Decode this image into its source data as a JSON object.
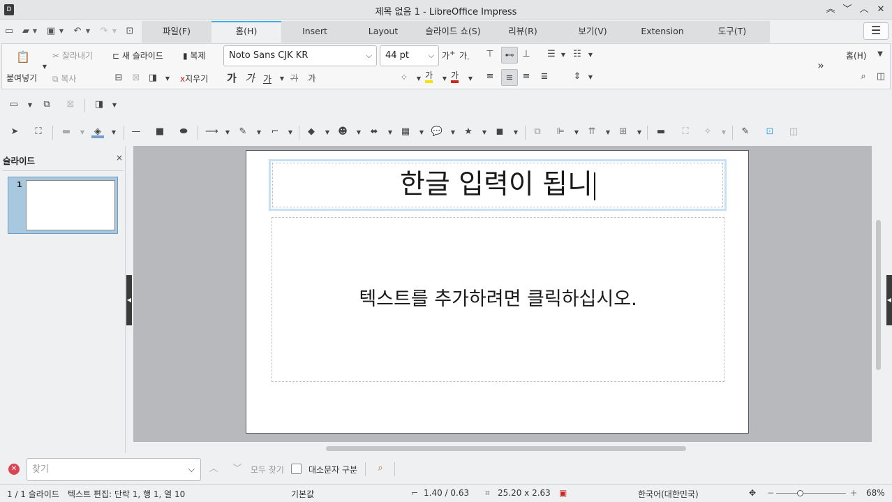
{
  "window": {
    "title": "제목 없음 1 - LibreOffice Impress"
  },
  "tabs": [
    {
      "label": "파일(F)"
    },
    {
      "label": "홈(H)"
    },
    {
      "label": "Insert"
    },
    {
      "label": "Layout"
    },
    {
      "label": "슬라이드 쇼(S)"
    },
    {
      "label": "리뷰(R)"
    },
    {
      "label": "보기(V)"
    },
    {
      "label": "Extension"
    },
    {
      "label": "도구(T)"
    }
  ],
  "ribbon": {
    "paste": "붙여넣기",
    "cut": "잘라내기",
    "copy": "복사",
    "new_slide": "새 슬라이드",
    "clone": "복제",
    "clear": "지우기",
    "font_name": "Noto Sans CJK KR",
    "font_size": "44 pt",
    "grow_font": "가",
    "shrink_font": "가",
    "bold": "가",
    "italic": "가",
    "underline": "가",
    "strike": "가",
    "shadow": "가",
    "highlight_glyph": "가",
    "font_color_glyph": "가",
    "mode_label": "홈(H)",
    "font_color": "#c42b1c",
    "highlight_color": "#f4e300"
  },
  "panel": {
    "title": "슬라이드",
    "slide_number": "1"
  },
  "slide": {
    "title_text": "한글 입력이 됩니",
    "body_placeholder": "텍스트를 추가하려면 클릭하십시오."
  },
  "find": {
    "placeholder": "찾기",
    "find_all": "모두 찾기",
    "match_case": "대소문자 구분"
  },
  "status": {
    "slide_pos": "1 / 1 슬라이드",
    "edit_info": "텍스트 편집: 단락 1, 행 1, 열 10",
    "master": "기본값",
    "position": "1.40 / 0.63",
    "size": "25.20 x 2.63",
    "language": "한국어(대한민국)",
    "zoom": "68%"
  }
}
